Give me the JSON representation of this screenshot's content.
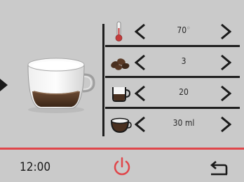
{
  "params": [
    {
      "name": "temperature",
      "value": "70",
      "unit_faint": "°",
      "icon": "thermometer-icon"
    },
    {
      "name": "coffee-strength",
      "value": "3",
      "icon": "coffee-beans-icon"
    },
    {
      "name": "coffee-amount",
      "value": "20",
      "icon": "small-cup-icon"
    },
    {
      "name": "milk-amount",
      "value": "30 ml",
      "icon": "bowl-icon"
    }
  ],
  "status": {
    "time": "12:00"
  },
  "colors": {
    "accent": "#e0464a",
    "thermo": "#c43a3a",
    "line": "#1e1e1e",
    "bg": "#cacaca"
  }
}
